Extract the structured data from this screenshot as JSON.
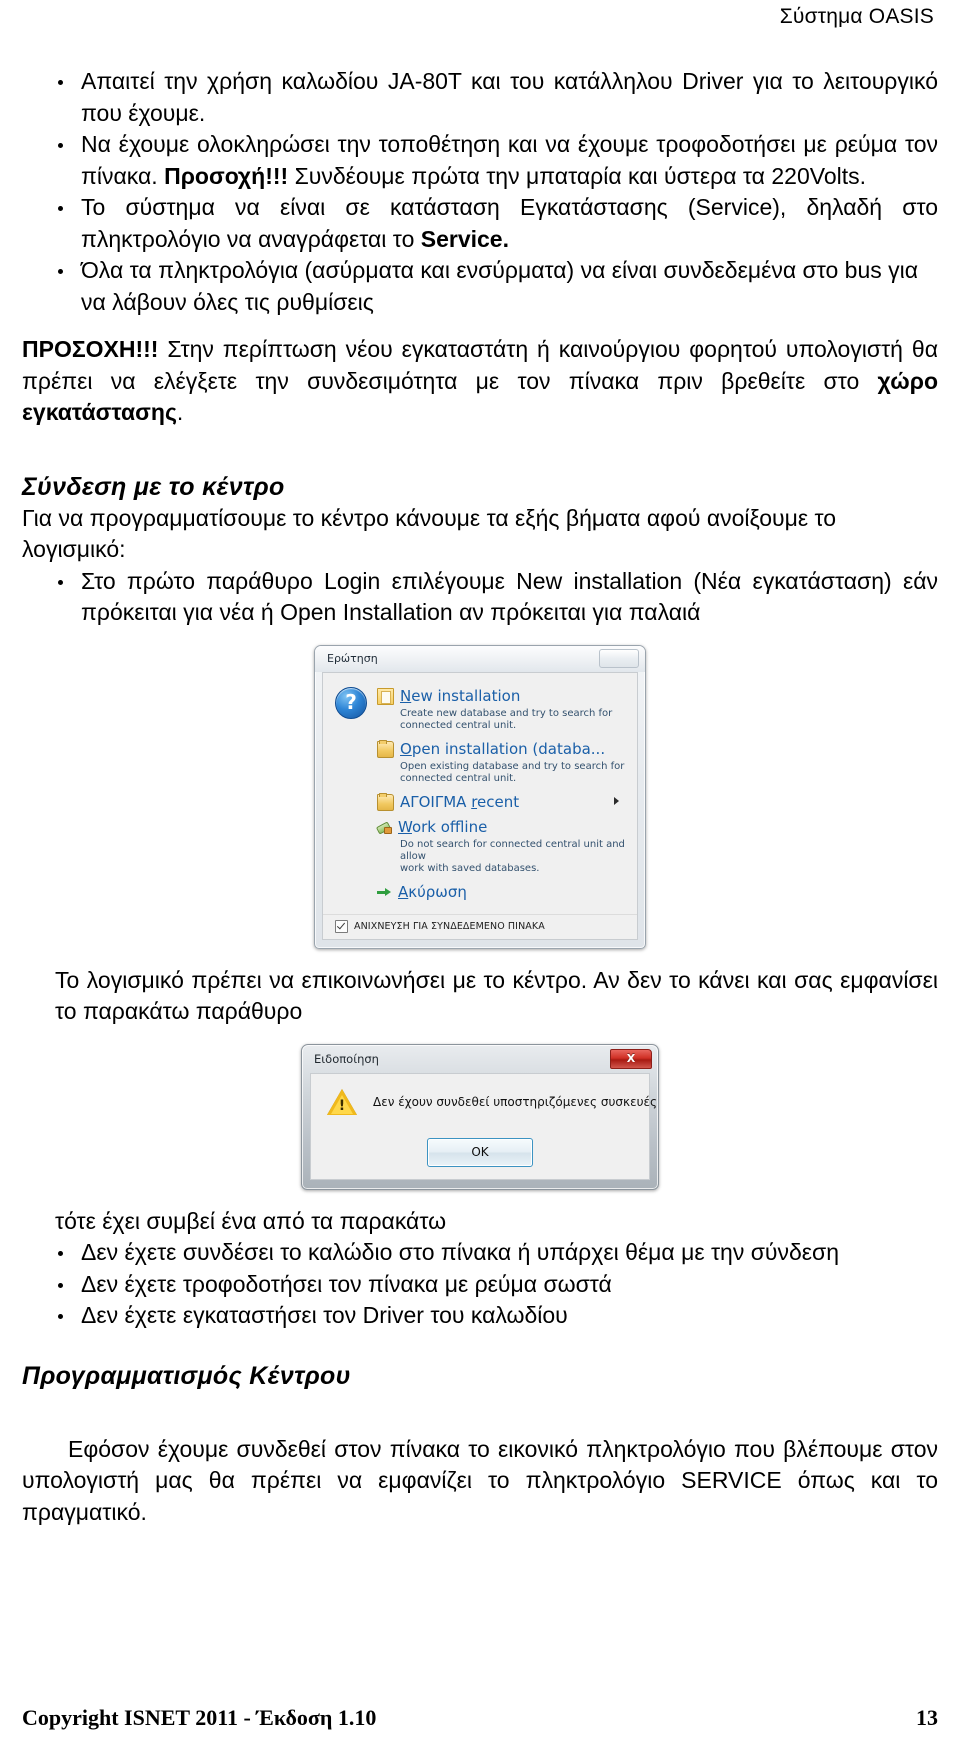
{
  "header": {
    "running_title": "Σύστημα OASIS"
  },
  "body": {
    "bullets_top": [
      "Απαιτεί την χρήση καλωδίου JA-80T και του κατάλληλου Driver για το λειτουργικό που έχουμε.",
      "Να έχουμε ολοκληρώσει την τοποθέτηση και να έχουμε τροφοδοτήσει με ρεύμα τον πίνακα. Προσοχή!!! Συνδέουμε πρώτα την μπαταρία και ύστερα τα 220Volts.",
      "Το σύστημα να είναι σε κατάσταση Εγκατάστασης (Service), δηλαδή στο πληκτρολόγιο να αναγράφεται το Service.",
      "Όλα τα πληκτρολόγια (ασύρματα και ενσύρματα) να είναι συνδεδεμένα στο bus για να λάβουν όλες τις ρυθμίσεις"
    ],
    "bullet2_bold": "Προσοχή!!!",
    "bullet3_bold": "Service.",
    "warning": {
      "lead": "ΠΡΟΣΟΧΗ!!!",
      "text": " Στην περίπτωση νέου εγκαταστάτη ή καινούργιου φορητού υπολογιστή θα πρέπει να ελέγξετε την συνδεσιμότητα με τον πίνακα πριν βρεθείτε στο ",
      "bold_tail": "χώρο εγκατάστασης",
      "tail": "."
    },
    "section1_title": "Σύνδεση με το κέντρο",
    "section1_intro": "Για να προγραμματίσουμε το κέντρο κάνουμε τα εξής βήματα αφού ανοίξουμε το λογισμικό:",
    "section1_bullet": "Στο πρώτο παράθυρο Login επιλέγουμε New installation (Νέα εγκατάσταση) εάν πρόκειται για νέα ή Open Installation αν πρόκειται για παλαιά",
    "after_shot1": "Το λογισμικό πρέπει να επικοινωνήσει με το κέντρο. Αν δεν το κάνει και σας εμφανίσει το παρακάτω παράθυρο",
    "after_shot2": "τότε έχει συμβεί ένα από τα παρακάτω",
    "bullets_bottom": [
      "Δεν έχετε συνδέσει το καλώδιο στο πίνακα ή υπάρχει θέμα με την σύνδεση",
      "Δεν έχετε τροφοδοτήσει τον πίνακα με ρεύμα σωστά",
      "Δεν έχετε εγκαταστήσει τον Driver του καλωδίου"
    ],
    "section2_title": "Προγραμματισμός Κέντρου",
    "section2_para": "Εφόσον έχουμε συνδεθεί στον πίνακα το εικονικό πληκτρολόγιο που βλέπουμε στον υπολογιστή μας θα πρέπει να εμφανίζει το πληκτρολόγιο SERVICE όπως και το πραγματικό."
  },
  "dialog_question": {
    "title": "Ερώτηση",
    "close_label": "",
    "icon": "question-icon",
    "items": [
      {
        "icon": "new-database-icon",
        "label_prefix": "",
        "accel": "N",
        "label_rest": "ew installation",
        "note": "Create new database and try to search for\nconnected central unit.",
        "has_submenu": false
      },
      {
        "icon": "folder-open-icon",
        "label_prefix": "",
        "accel": "O",
        "label_rest": "pen installation (databa...",
        "note": "Open existing database and try to search for\nconnected central unit.",
        "has_submenu": false
      },
      {
        "icon": "folder-recent-icon",
        "label_prefix": "ΑΓΟΙΓΜΑ ",
        "accel": "r",
        "label_rest": "ecent",
        "note": "",
        "has_submenu": true
      },
      {
        "icon": "plug-offline-icon",
        "label_prefix": "",
        "accel": "W",
        "label_rest": "ork offline",
        "note": "Do not search for connected central unit and allow\nwork with saved databases.",
        "has_submenu": false
      },
      {
        "icon": "green-arrow-icon",
        "label_prefix": "",
        "accel": "Α",
        "label_rest": "κύρωση",
        "note": "",
        "has_submenu": false
      }
    ],
    "checkbox": {
      "label": "ΑΝΙΧΝΕΥΣΗ ΓΙΑ ΣΥΝΔΕΔΕΜΕΝΟ ΠΙΝΑΚΑ",
      "checked": true
    }
  },
  "dialog_notice": {
    "title": "Ειδοποίηση",
    "close_label": "X",
    "icon": "warning-icon",
    "message": "Δεν έχουν συνδεθεί υποστηριζόμενες συσκευές",
    "ok_label": "OK"
  },
  "footer": {
    "copyright": "Copyright ISNET 2011 - Έκδοση 1.10",
    "page_number": "13"
  },
  "colors": {
    "page_bg": "#ffffff",
    "text": "#000000",
    "link_blue": "#1a5fa8",
    "close_red": "#cf2f25",
    "warn_yellow": "#f0b91c"
  }
}
